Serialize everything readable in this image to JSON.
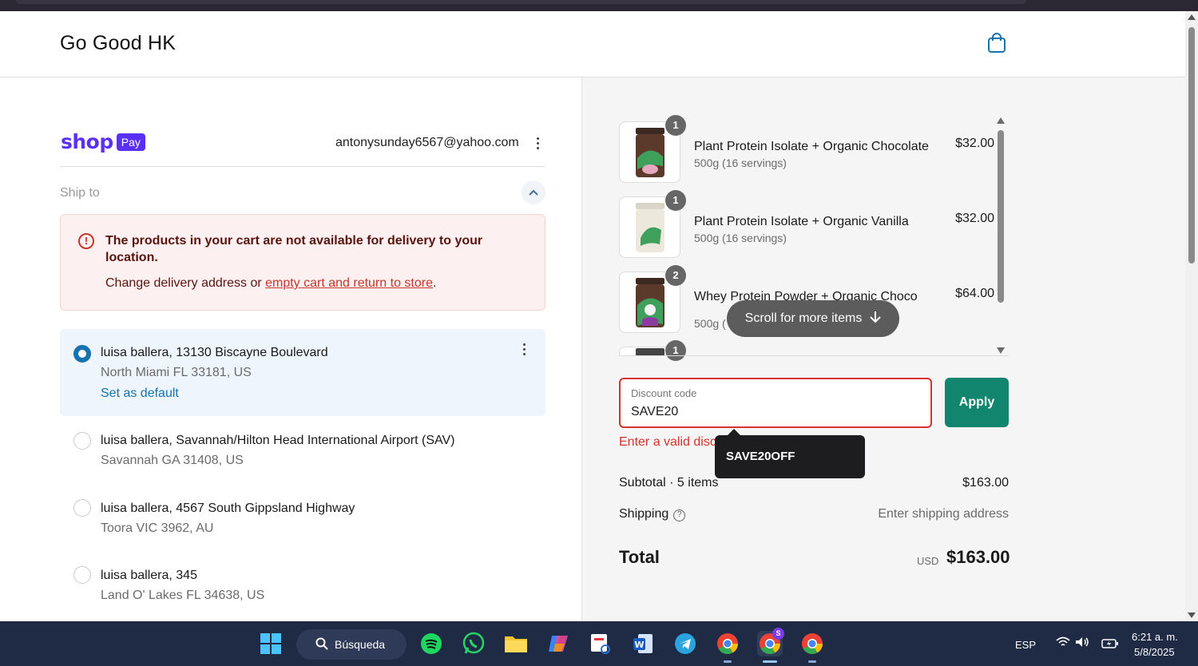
{
  "store": {
    "name": "Go Good HK",
    "bag_icon": "shopping-bag-icon"
  },
  "shop_pay": {
    "logo_text": "shop",
    "badge": "Pay",
    "email": "antonysunday6567@yahoo.com"
  },
  "ship_to": {
    "label": "Ship to"
  },
  "alert": {
    "title": "The products in your cart are not available for delivery to your location.",
    "body_prefix": "Change delivery address or ",
    "body_link": "empty cart and return to store",
    "body_suffix": "."
  },
  "addresses": [
    {
      "line1": "luisa ballera, 13130 Biscayne Boulevard",
      "line2": "North Miami FL 33181, US",
      "selected": true,
      "set_default": "Set as default"
    },
    {
      "line1": "luisa ballera, Savannah/Hilton Head International Airport (SAV)",
      "line2": "Savannah GA 31408, US",
      "selected": false
    },
    {
      "line1": "luisa ballera, 4567 South Gippsland Highway",
      "line2": "Toora VIC 3962, AU",
      "selected": false
    },
    {
      "line1": "luisa ballera, 345",
      "line2": "Land O' Lakes FL 34638, US",
      "selected": false
    }
  ],
  "cart": {
    "items": [
      {
        "qty": "1",
        "name": "Plant Protein Isolate + Organic Chocolate",
        "variant": "500g (16 servings)",
        "price": "$32.00"
      },
      {
        "qty": "1",
        "name": "Plant Protein Isolate + Organic Vanilla",
        "variant": "500g (16 servings)",
        "price": "$32.00"
      },
      {
        "qty": "2",
        "name": "Whey Protein Powder + Organic Choco",
        "variant": "500g (",
        "price": "$64.00"
      },
      {
        "qty": "1"
      }
    ],
    "scroll_hint": "Scroll for more items"
  },
  "discount": {
    "label": "Discount code",
    "value": "SAVE20",
    "apply": "Apply",
    "error": "Enter a valid disc",
    "suggestion": "SAVE20OFF"
  },
  "summary": {
    "subtotal_label": "Subtotal · 5 items",
    "subtotal_value": "$163.00",
    "shipping_label": "Shipping",
    "shipping_value": "Enter shipping address",
    "total_label": "Total",
    "currency": "USD",
    "total_value": "$163.00"
  },
  "taskbar": {
    "search": "Búsqueda",
    "lang": "ESP",
    "time": "6:21 a. m.",
    "date": "5/8/2025",
    "chrome_badge": "S"
  },
  "colors": {
    "accent": "#5a31f4",
    "apply": "#12856f",
    "error": "#d9312b",
    "link": "#1773b0"
  }
}
